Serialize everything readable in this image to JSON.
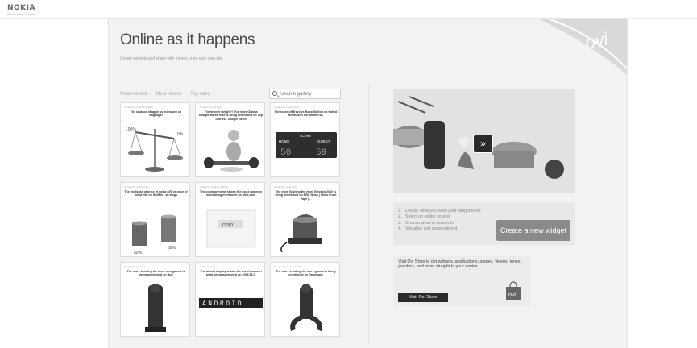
{
  "brand": {
    "logo": "NOKIA",
    "tagline": "Connecting People"
  },
  "page": {
    "title": "Online as it happens",
    "subtitle": "Create widgets and share with friends or on your own site"
  },
  "corner_logo": "ovi",
  "gallery": {
    "tabs": [
      "Most viewed",
      "Most recent",
      "Top rated"
    ],
    "search_placeholder": "Search gallery",
    "cards": [
      {
        "by": "Created by andrew.hildbell",
        "text": "The balance of apple vs microsoft on Engadget",
        "labels": [
          "100%",
          "0%"
        ],
        "icon": "scales-icon"
      },
      {
        "by": "Created by fond lopez",
        "text": "The heavier weight?! The more Obama Budget Marks Hike is being mentioned on Top Stories - Google News",
        "icon": "weight-figure-icon"
      },
      {
        "by": "Created by bravos.tritos",
        "text": "The score of Brazil vs Rossi Bolivia on Kaholi Wellmaster Forum and B...",
        "scoreboard": [
          "HOME",
          "SCORE",
          "GUEST",
          "50",
          "59"
        ],
        "icon": "scoreboard-icon"
      },
      {
        "by": "Created by david.bosey",
        "text": "The workload of price of nokia n97 vs price of nokia n96 on Stuff.tv - all blogs",
        "labels": [
          "50%",
          "50%"
        ],
        "icon": "coin-stacks-icon"
      },
      {
        "by": "Created by andrew.hildbell",
        "text": "The common name shows the most common word being mentioned on ohio.com",
        "icon": "paper-icon",
        "paper_label": "ohio"
      },
      {
        "by": "Created by quaretime",
        "text": "The more flashing the more Election 2010 is being mentioned on BBC News | News Front Page |...",
        "icon": "siren-icon"
      },
      {
        "by": "Created by quaretime",
        "text": "The more bending the more new games is being mentioned on Bud",
        "icon": "bending-figure-icon"
      },
      {
        "by": "Created by hajii",
        "text": "The airport display shows the most common word being mentioned on 2094.93.Q",
        "board_text": "ANDROID",
        "icon": "split-flap-icon"
      },
      {
        "by": "Created by JonFreak217",
        "text": "The more bending the more games is being mentioned on Gamespot",
        "icon": "bending-figure-icon"
      }
    ]
  },
  "hero": {
    "play_label": "»"
  },
  "steps": {
    "items": [
      {
        "n": "1.",
        "text": "Decide what you want your widget to do"
      },
      {
        "n": "2.",
        "text": "Select an online source"
      },
      {
        "n": "3.",
        "text": "Choose what to search for"
      },
      {
        "n": "4.",
        "text": "Visualise and personalise it"
      }
    ],
    "button_label": "Create a new widget"
  },
  "store": {
    "text": "Visit Ovi Store to get widgets, applications, games, videos, tones, graphics, and more straight to your device",
    "button_label": "Visit Ovi Store",
    "bag_label": "ovi"
  }
}
